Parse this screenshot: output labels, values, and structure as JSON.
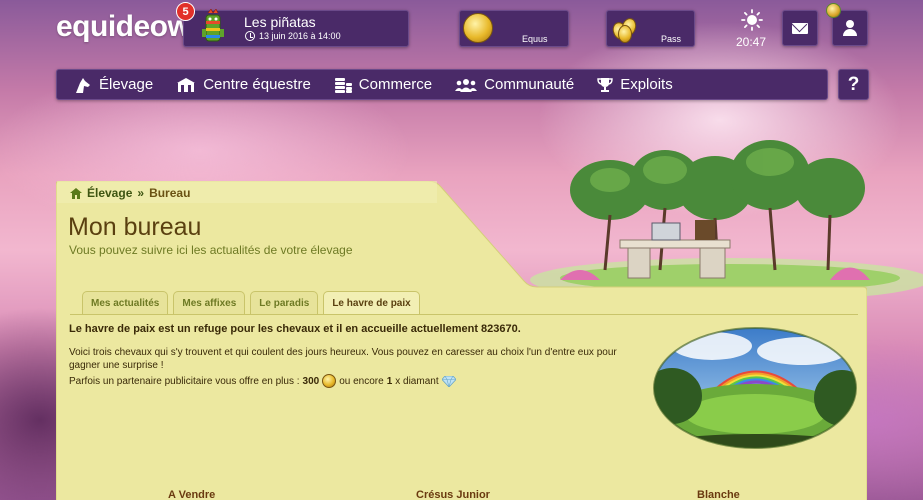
{
  "brand": {
    "logo_text": "equideow"
  },
  "event": {
    "badge_count": "5",
    "title": "Les piñatas",
    "date": "13 juin 2016 à 14:00",
    "icon": "pinata-icon"
  },
  "currencies": {
    "equus_label": "Equus",
    "pass_label": "Pass"
  },
  "weather": {
    "icon": "sun-icon",
    "time": "20:47"
  },
  "header_buttons": {
    "mail_icon": "mail-icon",
    "user_icon": "user-icon"
  },
  "nav": {
    "items": [
      {
        "label": "Élevage",
        "icon": "horse-head-icon"
      },
      {
        "label": "Centre équestre",
        "icon": "stable-icon"
      },
      {
        "label": "Commerce",
        "icon": "coins-icon"
      },
      {
        "label": "Communauté",
        "icon": "community-icon"
      },
      {
        "label": "Exploits",
        "icon": "trophy-icon"
      }
    ],
    "help_label": "?"
  },
  "breadcrumb": {
    "root": "Élevage",
    "separator": "»",
    "current": "Bureau"
  },
  "page": {
    "title": "Mon bureau",
    "subtitle": "Vous pouvez suivre ici les actualités de votre élevage"
  },
  "tabs": [
    {
      "label": "Mes actualités",
      "active": false
    },
    {
      "label": "Mes affixes",
      "active": false
    },
    {
      "label": "Le paradis",
      "active": false
    },
    {
      "label": "Le havre de paix",
      "active": true
    }
  ],
  "havre": {
    "lead": "Le havre de paix est un refuge pour les chevaux et il en accueille actuellement 823670.",
    "body": "Voici trois chevaux qui s'y trouvent et qui coulent des jours heureux. Vous pouvez en caresser au choix l'un d'entre eux pour gagner une surprise !",
    "partner_prefix": "Parfois un partenaire publicitaire vous offre en plus :",
    "partner_amount": "300",
    "partner_middle": "ou encore",
    "partner_count": "1",
    "partner_suffix": "x diamant"
  },
  "horses": [
    "A Vendre",
    "Crésus Junior",
    "Blanche"
  ],
  "colors": {
    "panel": "#4a2a68",
    "content_bg": "#ece8a0",
    "title": "#5a4010",
    "accent_green": "#6e7a24"
  }
}
